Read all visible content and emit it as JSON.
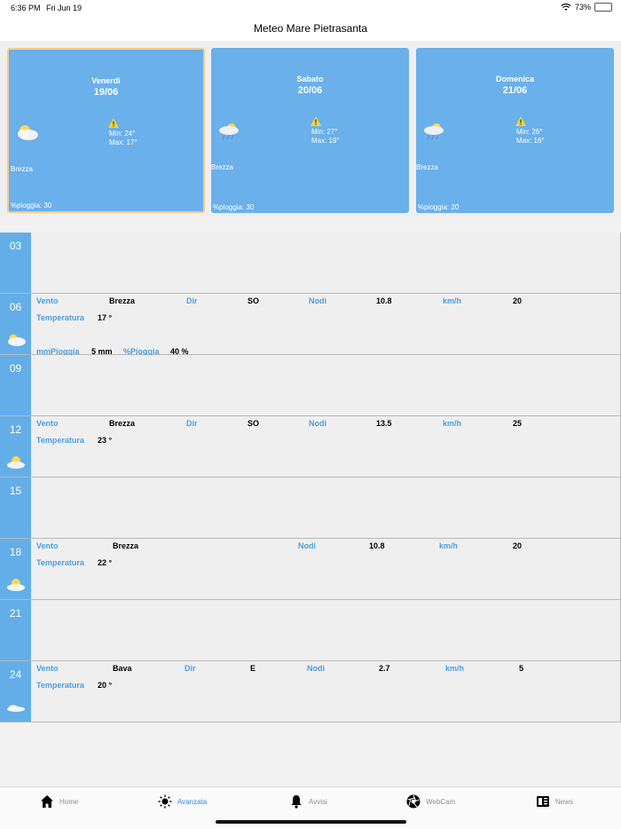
{
  "status": {
    "time": "6:36 PM",
    "date": "Fri Jun 19",
    "battery": "73%",
    "battery_level": 0.73
  },
  "header": {
    "title": "Meteo Mare Pietrasanta"
  },
  "days": [
    {
      "day": "Venerdì",
      "date": "19/06",
      "min": "Min: 24°",
      "max": "Max: 17°",
      "wind": "Brezza",
      "rain": "%pioggia: 30",
      "icon": "sun-cloud-icon"
    },
    {
      "day": "Sabato",
      "date": "20/06",
      "min": "Min: 27°",
      "max": "Max: 19°",
      "wind": "Brezza",
      "rain": "%pioggia: 30",
      "icon": "sun-rain-icon"
    },
    {
      "day": "Domenica",
      "date": "21/06",
      "min": "Min: 26°",
      "max": "Max: 16°",
      "wind": "Brezza",
      "rain": "%pioggia: 20",
      "icon": "sun-rain-icon"
    }
  ],
  "labels": {
    "wind": "Vento",
    "dir": "Dir",
    "knots": "Nodi",
    "kmh": "km/h",
    "temp": "Temperatura",
    "mm": "mmPioggia",
    "pct": "%Pioggia"
  },
  "hours": [
    {
      "h": "03"
    },
    {
      "h": "06",
      "wind": "Brezza",
      "dir": "SO",
      "knots": "10.8",
      "kmh": "20",
      "temp": "17 °",
      "mm": "5 mm",
      "pct": "40 %"
    },
    {
      "h": "09"
    },
    {
      "h": "12",
      "wind": "Brezza",
      "dir": "SO",
      "knots": "13.5",
      "kmh": "25",
      "temp": "23 °"
    },
    {
      "h": "15"
    },
    {
      "h": "18",
      "wind": "Brezza",
      "knots": "10.8",
      "kmh": "20",
      "temp": "22 °"
    },
    {
      "h": "21"
    },
    {
      "h": "24",
      "wind": "Bava",
      "dir": "E",
      "knots": "2.7",
      "kmh": "5",
      "temp": "20 °"
    }
  ],
  "tabs": [
    {
      "label": "Home",
      "icon": "home-icon"
    },
    {
      "label": "Avanzata",
      "icon": "sun-icon",
      "active": true
    },
    {
      "label": "Avvisi",
      "icon": "bell-icon"
    },
    {
      "label": "WebCam",
      "icon": "camera-aperture-icon"
    },
    {
      "label": "News",
      "icon": "news-icon"
    }
  ]
}
